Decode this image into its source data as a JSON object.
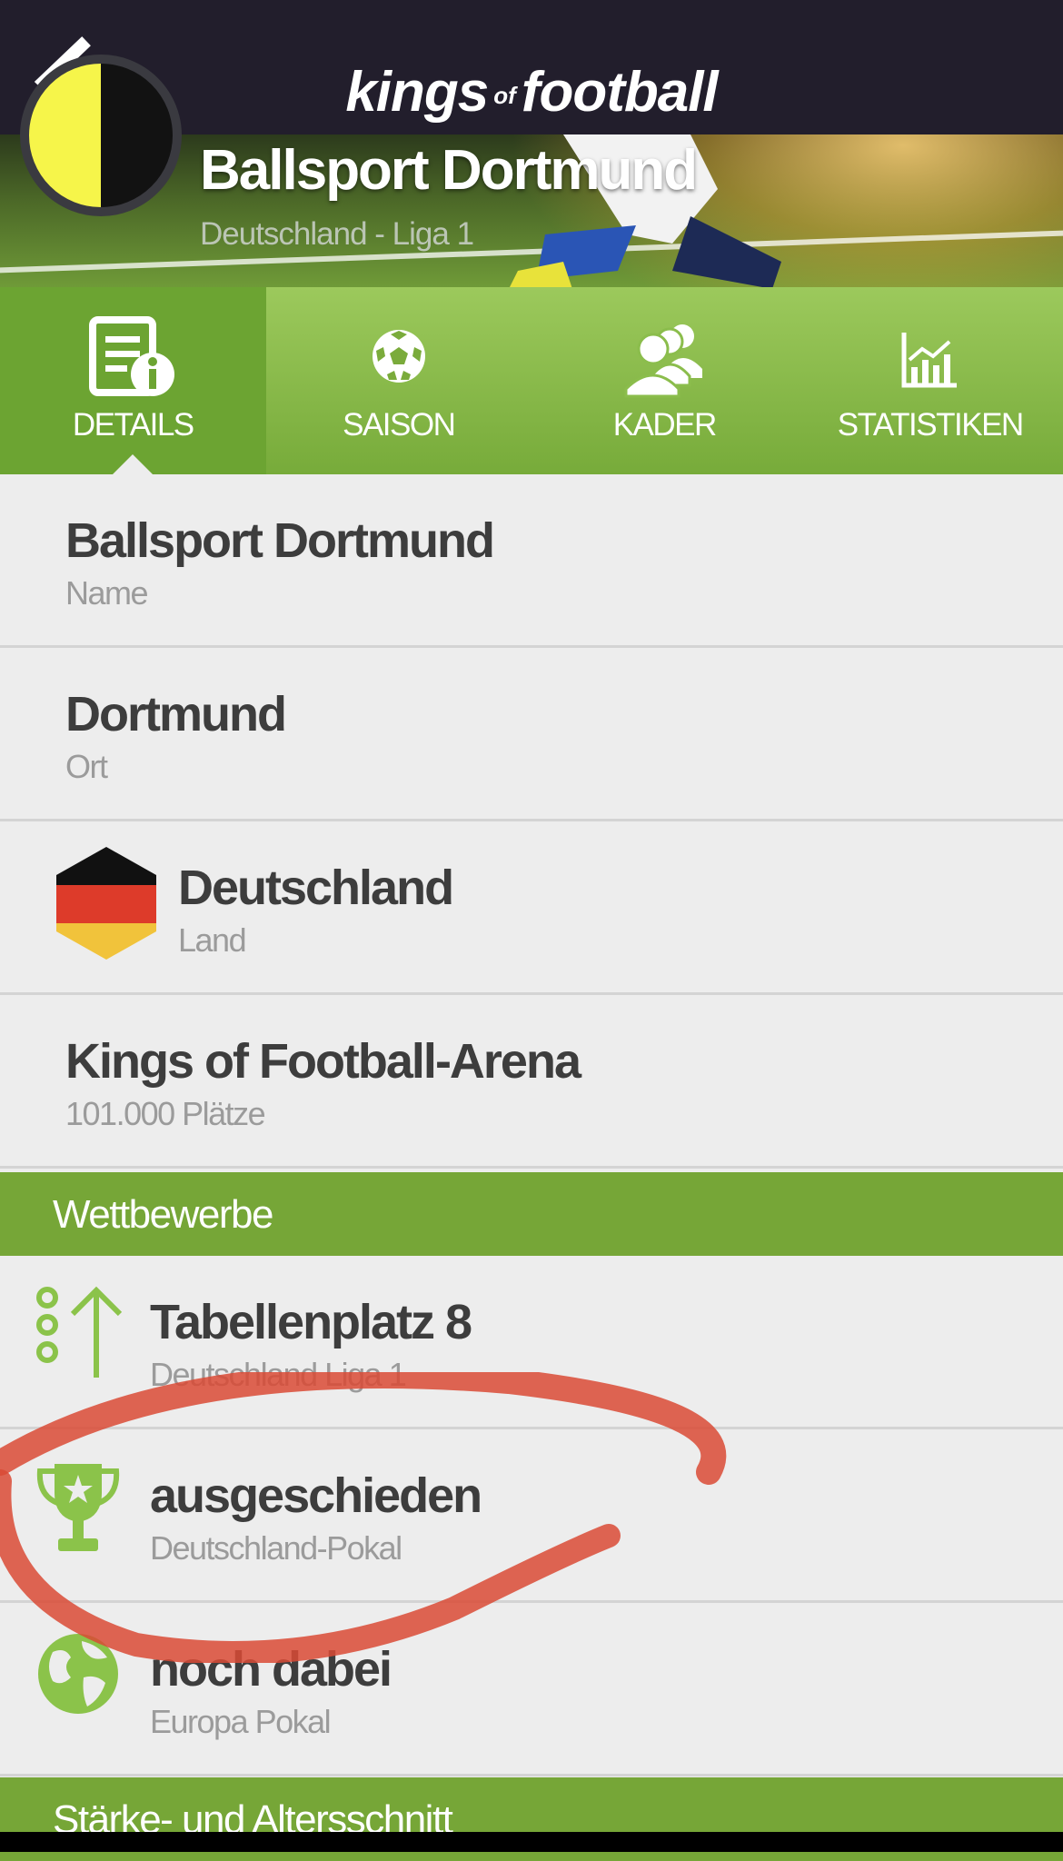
{
  "header": {
    "brand_main": "kings",
    "brand_of": "of",
    "brand_second": "football"
  },
  "banner": {
    "club_name": "Ballsport Dortmund",
    "league": "Deutschland - Liga 1"
  },
  "tabs": [
    {
      "label": "DETAILS",
      "icon": "details-icon",
      "active": true
    },
    {
      "label": "SAISON",
      "icon": "soccer-ball-icon"
    },
    {
      "label": "KADER",
      "icon": "team-icon"
    },
    {
      "label": "STATISTIKEN",
      "icon": "statistics-icon"
    }
  ],
  "details": {
    "name": {
      "value": "Ballsport Dortmund",
      "label": "Name"
    },
    "city": {
      "value": "Dortmund",
      "label": "Ort"
    },
    "country": {
      "value": "Deutschland",
      "label": "Land",
      "flag_colors": [
        "#111111",
        "#dd3b2a",
        "#f1c33b"
      ]
    },
    "stadium": {
      "value": "Kings of Football-Arena",
      "label": "101.000 Plätze"
    }
  },
  "competitions": {
    "header": "Wettbewerbe",
    "items": [
      {
        "title": "Tabellenplatz 8",
        "subtitle": "Deutschland Liga 1",
        "icon": "table-position-icon"
      },
      {
        "title": "ausgeschieden",
        "subtitle": "Deutschland-Pokal",
        "icon": "trophy-icon"
      },
      {
        "title": "noch dabei",
        "subtitle": "Europa Pokal",
        "icon": "globe-icon"
      }
    ]
  },
  "strength_section": {
    "header": "Stärke- und Altersschnitt"
  },
  "colors": {
    "accent_green": "#76a637",
    "icon_green": "#8bc34a",
    "top_bar": "#221e2c",
    "annotation_red": "#d94a35"
  }
}
